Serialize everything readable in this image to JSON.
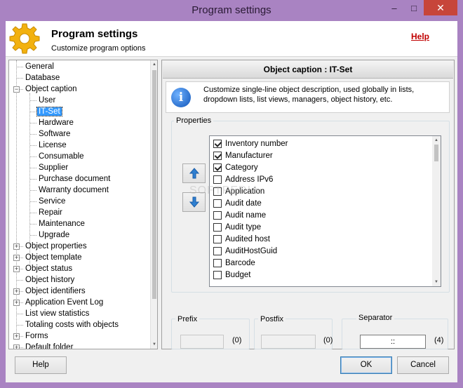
{
  "window": {
    "title": "Program settings",
    "controls": {
      "minimize": "–",
      "maximize": "□",
      "close": "✕"
    }
  },
  "header": {
    "title": "Program settings",
    "subtitle": "Customize program options",
    "help_link": "Help",
    "icon": "gear-icon"
  },
  "tree": {
    "items": [
      {
        "label": "General"
      },
      {
        "label": "Database"
      },
      {
        "label": "Object caption",
        "expander": "−"
      },
      {
        "label": "User"
      },
      {
        "label": "IT-Set",
        "selected": true
      },
      {
        "label": "Hardware"
      },
      {
        "label": "Software"
      },
      {
        "label": "License"
      },
      {
        "label": "Consumable"
      },
      {
        "label": "Supplier"
      },
      {
        "label": "Purchase document"
      },
      {
        "label": "Warranty document"
      },
      {
        "label": "Service"
      },
      {
        "label": "Repair"
      },
      {
        "label": "Maintenance"
      },
      {
        "label": "Upgrade"
      },
      {
        "label": "Object properties",
        "expander": "+"
      },
      {
        "label": "Object template",
        "expander": "+"
      },
      {
        "label": "Object status",
        "expander": "+"
      },
      {
        "label": "Object history"
      },
      {
        "label": "Object identifiers",
        "expander": "+"
      },
      {
        "label": "Application Event Log",
        "expander": "+"
      },
      {
        "label": "List view statistics"
      },
      {
        "label": "Totaling costs with objects"
      },
      {
        "label": "Forms",
        "expander": "+"
      },
      {
        "label": "Default folder",
        "expander": "+"
      }
    ]
  },
  "panel": {
    "title": "Object caption : IT-Set",
    "info_text": "Customize single-line object description, used globally in lists, dropdown lists, list views, managers, object history, etc.",
    "properties_label": "Properties",
    "properties": [
      {
        "label": "Inventory number",
        "checked": true
      },
      {
        "label": "Manufacturer",
        "checked": true
      },
      {
        "label": "Category",
        "checked": true
      },
      {
        "label": "Address IPv6",
        "checked": false
      },
      {
        "label": "Application",
        "checked": false
      },
      {
        "label": "Audit date",
        "checked": false
      },
      {
        "label": "Audit name",
        "checked": false
      },
      {
        "label": "Audit type",
        "checked": false
      },
      {
        "label": "Audited host",
        "checked": false
      },
      {
        "label": "AuditHostGuid",
        "checked": false
      },
      {
        "label": "Barcode",
        "checked": false
      },
      {
        "label": "Budget",
        "checked": false
      }
    ],
    "prefix": {
      "label": "Prefix",
      "value": "",
      "count": "(0)"
    },
    "postfix": {
      "label": "Postfix",
      "value": "",
      "count": "(0)"
    },
    "separator": {
      "label": "Separator",
      "value": "::",
      "count": "(4)"
    }
  },
  "watermark": "SOFTPEDIA",
  "footer": {
    "help_button": "Help",
    "ok_button": "OK",
    "cancel_button": "Cancel"
  },
  "colors": {
    "window_frame": "#a983c2",
    "close_button": "#c7453a",
    "help_link": "#c00000",
    "selection": "#3399ff"
  }
}
